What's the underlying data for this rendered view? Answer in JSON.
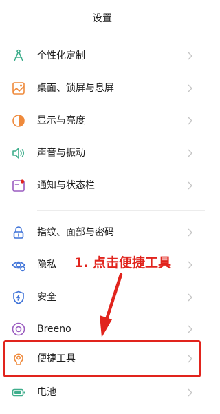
{
  "header": {
    "title": "设置"
  },
  "menu": {
    "items": [
      {
        "label": "个性化定制",
        "icon": "compass-icon"
      },
      {
        "label": "桌面、锁屏与息屏",
        "icon": "wallpaper-icon"
      },
      {
        "label": "显示与亮度",
        "icon": "brightness-icon"
      },
      {
        "label": "声音与振动",
        "icon": "volume-icon"
      },
      {
        "label": "通知与状态栏",
        "icon": "notification-icon"
      },
      {
        "label": "指纹、面部与密码",
        "icon": "lock-icon"
      },
      {
        "label": "隐私",
        "icon": "privacy-eye-icon"
      },
      {
        "label": "安全",
        "icon": "shield-icon"
      },
      {
        "label": "Breeno",
        "icon": "breeno-icon"
      },
      {
        "label": "便捷工具",
        "icon": "convenient-tools-icon"
      },
      {
        "label": "电池",
        "icon": "battery-icon"
      }
    ]
  },
  "annotation": {
    "text": "1. 点击便捷工具"
  },
  "colors": {
    "accent_green": "#3fae8c",
    "accent_orange": "#ef8a3c",
    "accent_blue": "#3f73d8",
    "accent_purple": "#9a5cc0",
    "annotation_red": "#e1241d",
    "chevron_gray": "#c5c5c5"
  }
}
